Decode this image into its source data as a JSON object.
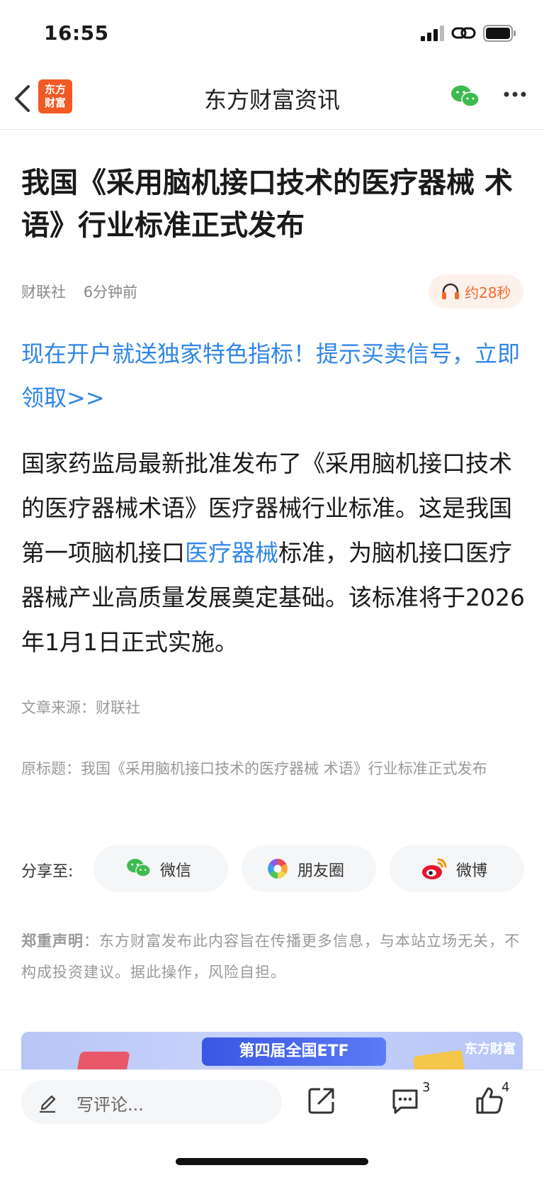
{
  "status": {
    "time": "16:55"
  },
  "nav": {
    "title": "东方财富资讯",
    "logo_text": "东方\n财富"
  },
  "article": {
    "title": "我国《采用脑机接口技术的医疗器械 术语》行业标准正式发布",
    "source": "财联社",
    "time_ago": "6分钟前",
    "audio_label": "约28秒",
    "promo": "现在开户就送独家特色指标！提示买卖信号，立即领取>>",
    "body_part1": "国家药监局最新批准发布了《采用脑机接口技术的医疗器械术语》医疗器械行业标准。这是我国第一项脑机接口",
    "body_link": "医疗器械",
    "body_part2": "标准，为脑机接口医疗器械产业高质量发展奠定基础。该标准将于2026年1月1日正式实施。",
    "source_line": "文章来源：财联社",
    "original_title": "原标题：我国《采用脑机接口技术的医疗器械 术语》行业标准正式发布"
  },
  "share": {
    "label": "分享至:",
    "wechat": "微信",
    "moments": "朋友圈",
    "weibo": "微博"
  },
  "disclaimer": {
    "heading": "郑重声明",
    "text": "：东方财富发布此内容旨在传播更多信息，与本站立场无关，不构成投资建议。据此操作，风险自担。"
  },
  "banner": {
    "title": "第四届全国ETF",
    "brand": "东方财富"
  },
  "bottom": {
    "comment_placeholder": "写评论...",
    "comment_count": "3",
    "like_count": "4"
  },
  "colors": {
    "accent": "#2f86e6",
    "brand": "#f15a24",
    "wechat": "#3dbb4e"
  }
}
